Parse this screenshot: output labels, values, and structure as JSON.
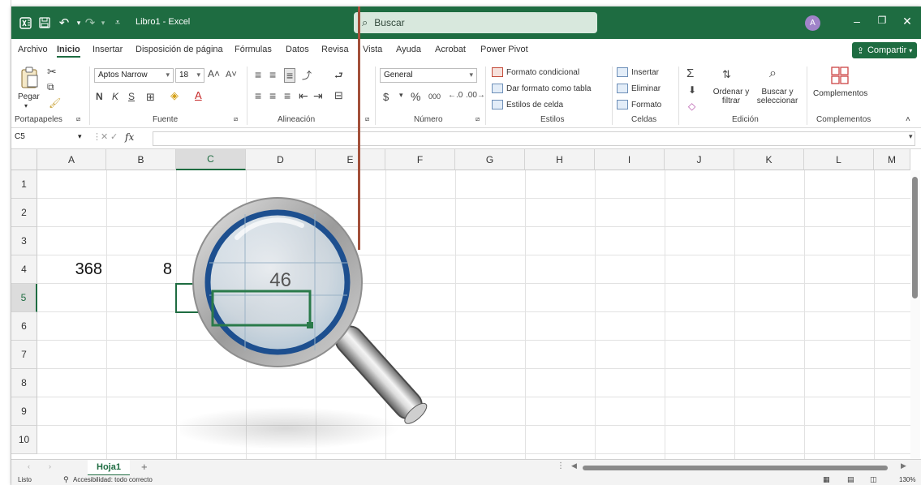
{
  "title_bar": {
    "doc_title": "Libro1 - Excel",
    "search_placeholder": "Buscar",
    "avatar_initial": "A",
    "undo_icon": "undo-icon",
    "redo_icon": "redo-icon",
    "save_icon": "save-icon"
  },
  "menu": {
    "items": [
      "Archivo",
      "Inicio",
      "Insertar",
      "Disposición de página",
      "Fórmulas",
      "Datos",
      "Revisa",
      "Vista",
      "Ayuda",
      "Acrobat",
      "Power Pivot"
    ],
    "active": "Inicio",
    "share": "Compartir"
  },
  "ribbon": {
    "clipboard": {
      "paste": "Pegar",
      "label": "Portapapeles"
    },
    "font": {
      "name": "Aptos Narrow",
      "size": "18",
      "bold": "N",
      "italic": "K",
      "underline": "S",
      "label": "Fuente"
    },
    "alignment": {
      "label": "Alineación"
    },
    "number": {
      "format": "General",
      "currency": "$",
      "percent": "%",
      "thousands": "000",
      "label": "Número"
    },
    "styles": {
      "conditional": "Formato condicional",
      "table": "Dar formato como tabla",
      "cell_styles": "Estilos de celda",
      "label": "Estilos"
    },
    "cells": {
      "insert": "Insertar",
      "delete": "Eliminar",
      "format": "Formato",
      "label": "Celdas"
    },
    "editing": {
      "sort": "Ordenar y filtrar",
      "find": "Buscar y seleccionar",
      "label": "Edición"
    },
    "addins": {
      "button": "Complementos",
      "label": "Complementos"
    }
  },
  "formula_bar": {
    "name_box": "C5",
    "fx": "fx"
  },
  "grid": {
    "columns": [
      "A",
      "B",
      "C",
      "D",
      "E",
      "F",
      "G",
      "H",
      "I",
      "J",
      "K",
      "L",
      "M"
    ],
    "rows": [
      "1",
      "2",
      "3",
      "4",
      "5",
      "6",
      "7",
      "8",
      "9",
      "10"
    ],
    "selected_column": "C",
    "selected_row": "5",
    "cells": {
      "A4": "368",
      "B4": "8"
    },
    "magnified_value": "46"
  },
  "sheet_tabs": {
    "active": "Hoja1",
    "add": "+"
  },
  "status_bar": {
    "ready": "Listo",
    "accessibility": "Accesibilidad: todo correcto",
    "zoom": "130%"
  },
  "colors": {
    "excel_green": "#1e6c41",
    "pointer_line": "#a3503a",
    "lens_ring": "#1d4f8f"
  }
}
